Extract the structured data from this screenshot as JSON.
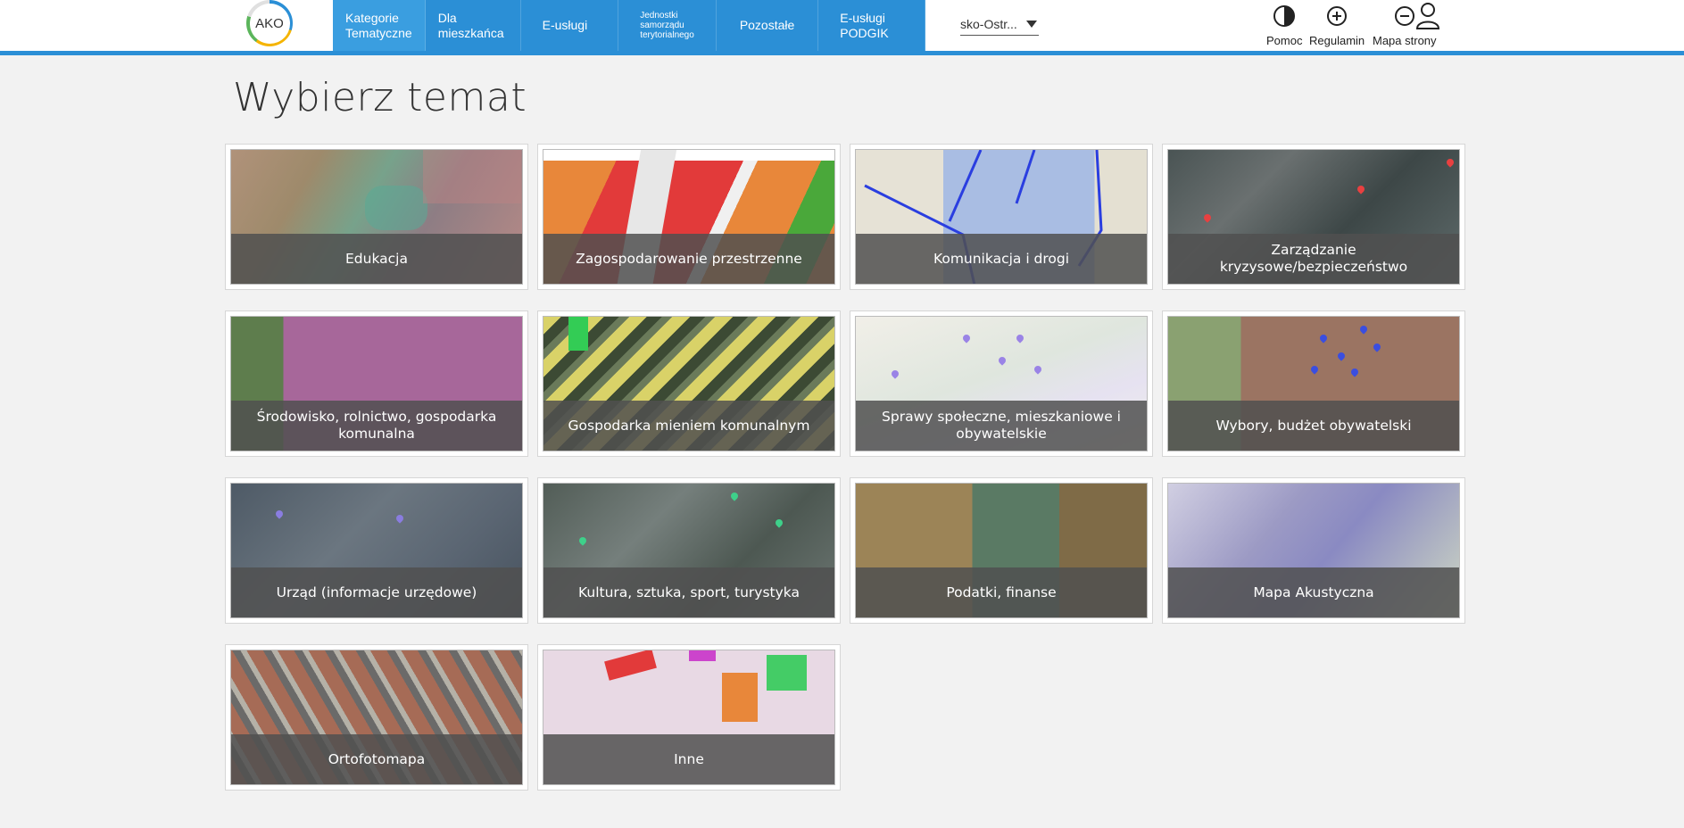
{
  "header": {
    "logo_text": "AKO",
    "nav": [
      {
        "label": "Kategorie\nTematyczne"
      },
      {
        "label": "Dla\nmieszkańca"
      },
      {
        "label": "E-usługi"
      },
      {
        "label": "Jednostki\nsamorządu\nterytorialnego"
      },
      {
        "label": "Pozostałe"
      },
      {
        "label": "E-usługi\nPODGIK"
      }
    ],
    "region_select_value": "sko-Ostr...",
    "tools": [
      {
        "label": "Pomoc",
        "icon": "contrast-icon"
      },
      {
        "label": "Regulamin",
        "icon": "zoom-in-icon"
      },
      {
        "label": "Mapa strony",
        "icon": "zoom-out-icon"
      },
      {
        "label": "",
        "icon": "user-icon"
      }
    ]
  },
  "main": {
    "title": "Wybierz temat",
    "tiles": [
      {
        "label": "Edukacja"
      },
      {
        "label": "Zagospodarowanie przestrzenne"
      },
      {
        "label": "Komunikacja i drogi"
      },
      {
        "label": "Zarządzanie kryzysowe/bezpieczeństwo"
      },
      {
        "label": "Środowisko, rolnictwo, gospodarka komunalna"
      },
      {
        "label": "Gospodarka mieniem komunalnym"
      },
      {
        "label": "Sprawy społeczne, mieszkaniowe i obywatelskie"
      },
      {
        "label": "Wybory, budżet obywatelski"
      },
      {
        "label": "Urząd (informacje urzędowe)"
      },
      {
        "label": "Kultura, sztuka, sport, turystyka"
      },
      {
        "label": "Podatki, finanse"
      },
      {
        "label": "Mapa Akustyczna"
      },
      {
        "label": "Ortofotomapa"
      },
      {
        "label": "Inne"
      }
    ]
  },
  "colors": {
    "accent": "#2b8fd6",
    "background": "#f2f2f2",
    "caption_overlay": "#505050"
  }
}
